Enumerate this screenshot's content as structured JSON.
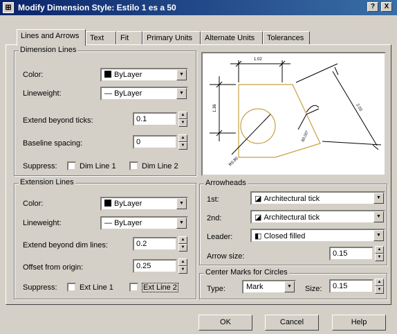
{
  "window": {
    "title": "Modify Dimension Style: Estilo 1 es a 50",
    "help_btn": "?",
    "close_btn": "X",
    "app_icon": "dimension-style-icon"
  },
  "tabs": [
    "Lines and Arrows",
    "Text",
    "Fit",
    "Primary Units",
    "Alternate Units",
    "Tolerances"
  ],
  "dimension_lines": {
    "group_title": "Dimension Lines",
    "color_label": "Color:",
    "color_value": "ByLayer",
    "lineweight_label": "Lineweight:",
    "lineweight_value": "ByLayer",
    "extend_label": "Extend beyond ticks:",
    "extend_value": "0.1",
    "baseline_label": "Baseline spacing:",
    "baseline_value": "0",
    "suppress_label": "Suppress:",
    "dim1_label": "Dim Line 1",
    "dim2_label": "Dim Line 2"
  },
  "extension_lines": {
    "group_title": "Extension Lines",
    "color_label": "Color:",
    "color_value": "ByLayer",
    "lineweight_label": "Lineweight:",
    "lineweight_value": "ByLayer",
    "extend_label": "Extend beyond dim lines:",
    "extend_value": "0.2",
    "offset_label": "Offset from origin:",
    "offset_value": "0.25",
    "suppress_label": "Suppress:",
    "ext1_label": "Ext Line 1",
    "ext2_label": "Ext Line 2"
  },
  "preview": {
    "dim_top": "1.02",
    "dim_left": "1.36",
    "dim_right": "2.02",
    "dim_angle": "60.00°",
    "dim_radius": "R0.80"
  },
  "arrowheads": {
    "group_title": "Arrowheads",
    "first_label": "1st:",
    "first_value": "Architectural tick",
    "second_label": "2nd:",
    "second_value": "Architectural tick",
    "leader_label": "Leader:",
    "leader_value": "Closed filled",
    "arrowsize_label": "Arrow size:",
    "arrowsize_value": "0.15"
  },
  "center_marks": {
    "group_title": "Center Marks for Circles",
    "type_label": "Type:",
    "type_value": "Mark",
    "size_label": "Size:",
    "size_value": "0.15"
  },
  "buttons": {
    "ok": "OK",
    "cancel": "Cancel",
    "help": "Help"
  }
}
